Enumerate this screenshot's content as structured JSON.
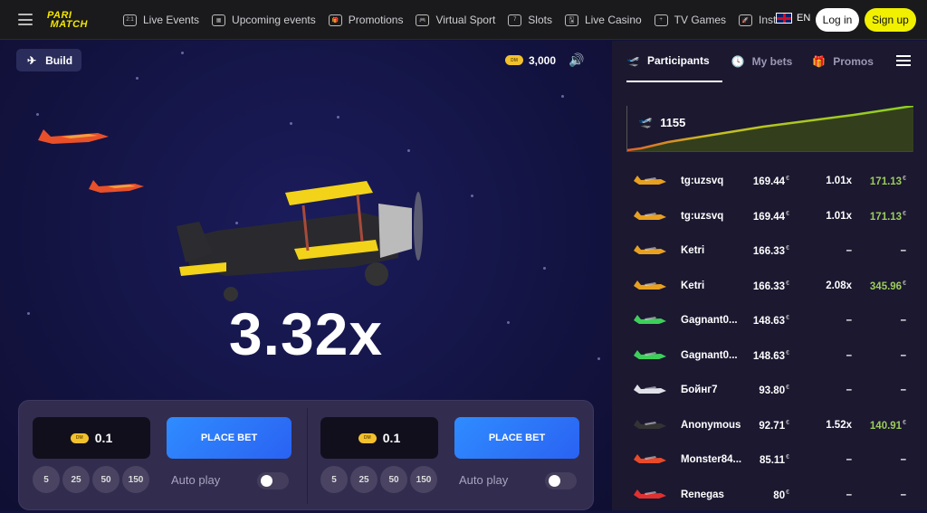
{
  "header": {
    "brand": "PARI MATCH",
    "nav": [
      {
        "label": "Live Events",
        "icon": "live-events-icon"
      },
      {
        "label": "Upcoming events",
        "icon": "calendar-icon"
      },
      {
        "label": "Promotions",
        "icon": "gift-icon"
      },
      {
        "label": "Virtual Sport",
        "icon": "gamepad-icon"
      },
      {
        "label": "Slots",
        "icon": "slots-icon"
      },
      {
        "label": "Live Casino",
        "icon": "cards-icon"
      },
      {
        "label": "TV Games",
        "icon": "tv-games-icon"
      },
      {
        "label": "Instant",
        "icon": "rocket-icon"
      }
    ],
    "language": "EN",
    "login": "Log in",
    "signup": "Sign up"
  },
  "game": {
    "mode_label": "Build",
    "balance": "3,000",
    "currency_badge": "DM",
    "multiplier": "3.32x"
  },
  "bets": [
    {
      "amount": "0.1",
      "place_label": "PLACE BET",
      "chips": [
        "5",
        "25",
        "50",
        "150"
      ],
      "auto_label": "Auto play",
      "auto_on": false
    },
    {
      "amount": "0.1",
      "place_label": "PLACE BET",
      "chips": [
        "5",
        "25",
        "50",
        "150"
      ],
      "auto_label": "Auto play",
      "auto_on": false
    }
  ],
  "panel": {
    "tabs": [
      "Participants",
      "My bets",
      "Promos"
    ],
    "active_tab": "Participants",
    "participants_count": "1155",
    "currency": "€",
    "rows": [
      {
        "name": "tg:uzsvq",
        "bet": "169.44",
        "mult": "1.01x",
        "win": "171.13",
        "plane_color": "#e8a020"
      },
      {
        "name": "tg:uzsvq",
        "bet": "169.44",
        "mult": "1.01x",
        "win": "171.13",
        "plane_color": "#e8a020"
      },
      {
        "name": "Ketri",
        "bet": "166.33",
        "mult": "–",
        "win": "–",
        "plane_color": "#e8a020"
      },
      {
        "name": "Ketri",
        "bet": "166.33",
        "mult": "2.08x",
        "win": "345.96",
        "plane_color": "#e8a020"
      },
      {
        "name": "Gagnant0...",
        "bet": "148.63",
        "mult": "–",
        "win": "–",
        "plane_color": "#3ecf5a"
      },
      {
        "name": "Gagnant0...",
        "bet": "148.63",
        "mult": "–",
        "win": "–",
        "plane_color": "#3ecf5a"
      },
      {
        "name": "Бойнг7",
        "bet": "93.80",
        "mult": "–",
        "win": "–",
        "plane_color": "#e0e0e8"
      },
      {
        "name": "Anonymous",
        "bet": "92.71",
        "mult": "1.52x",
        "win": "140.91",
        "plane_color": "#333333"
      },
      {
        "name": "Monster84...",
        "bet": "85.11",
        "mult": "–",
        "win": "–",
        "plane_color": "#e84a2a"
      },
      {
        "name": "Renegas",
        "bet": "80",
        "mult": "–",
        "win": "–",
        "plane_color": "#e03030"
      }
    ]
  },
  "colors": {
    "accent_yellow": "#f3e600",
    "place_bet_blue": "#2f7cff",
    "win_green": "#9ccc5a"
  }
}
